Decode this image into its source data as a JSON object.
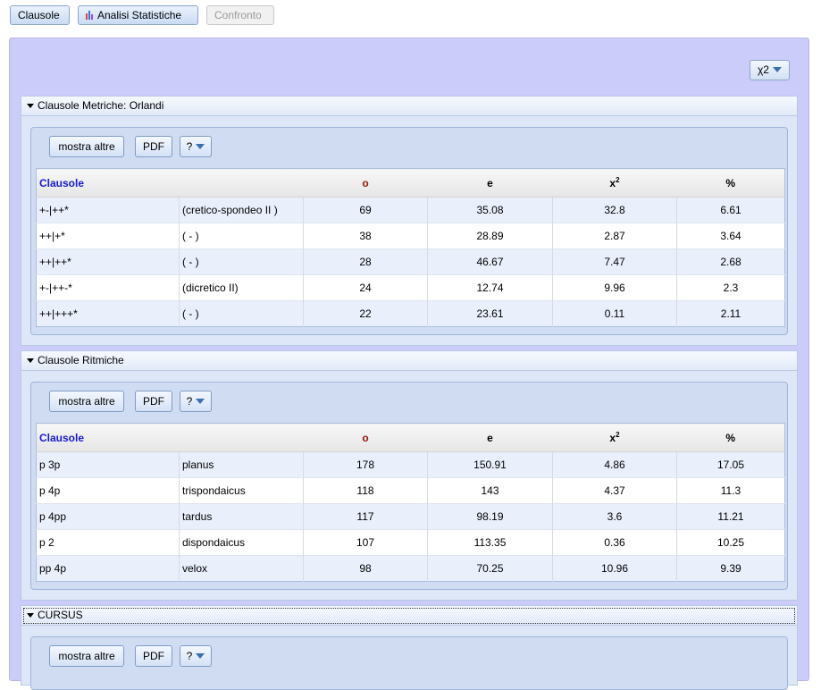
{
  "toolbar": {
    "clausole": "Clausole",
    "analisi": "Analisi Statistiche",
    "confronto": "Confronto"
  },
  "chi_dropdown": "χ2",
  "columns": {
    "c0": "Clausole",
    "o": "o",
    "e": "e",
    "x2": "x",
    "x2_sup": "2",
    "pct": "%"
  },
  "buttons": {
    "mostra": "mostra altre",
    "pdf": "PDF",
    "help": "?"
  },
  "sections": [
    {
      "title": "Clausole Metriche: Orlandi",
      "rows": [
        [
          "+-|++*",
          "(cretico-spondeo II )",
          "69",
          "35.08",
          "32.8",
          "6.61"
        ],
        [
          "++|+*",
          "( - )",
          "38",
          "28.89",
          "2.87",
          "3.64"
        ],
        [
          "++|++*",
          "( - )",
          "28",
          "46.67",
          "7.47",
          "2.68"
        ],
        [
          "+-|++-*",
          "(dicretico II)",
          "24",
          "12.74",
          "9.96",
          "2.3"
        ],
        [
          "++|+++*",
          "( - )",
          "22",
          "23.61",
          "0.11",
          "2.11"
        ]
      ]
    },
    {
      "title": "Clausole Ritmiche",
      "rows": [
        [
          "p 3p",
          "planus",
          "178",
          "150.91",
          "4.86",
          "17.05"
        ],
        [
          "p 4p",
          "trispondaicus",
          "118",
          "143",
          "4.37",
          "11.3"
        ],
        [
          "p 4pp",
          "tardus",
          "117",
          "98.19",
          "3.6",
          "11.21"
        ],
        [
          "p 2",
          "dispondaicus",
          "107",
          "113.35",
          "0.36",
          "10.25"
        ],
        [
          "pp 4p",
          "velox",
          "98",
          "70.25",
          "10.96",
          "9.39"
        ]
      ]
    },
    {
      "title": "CURSUS",
      "rows": []
    }
  ]
}
